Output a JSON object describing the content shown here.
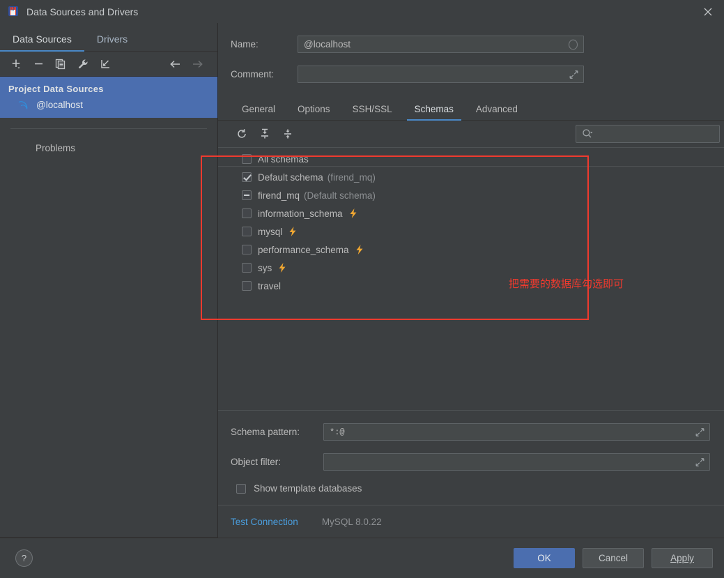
{
  "window": {
    "title": "Data Sources and Drivers",
    "app_icon": "intellij-idea-icon",
    "close_icon": "close-icon"
  },
  "sidebar": {
    "tabs": [
      {
        "label": "Data Sources",
        "selected": true
      },
      {
        "label": "Drivers",
        "selected": false
      }
    ],
    "toolbar": [
      {
        "name": "add-button",
        "icon": "plus-icon"
      },
      {
        "name": "remove-button",
        "icon": "minus-icon"
      },
      {
        "name": "duplicate-button",
        "icon": "copy-icon"
      },
      {
        "name": "properties-button",
        "icon": "wrench-icon"
      },
      {
        "name": "import-button",
        "icon": "import-arrow-icon"
      },
      {
        "name": "back-button",
        "icon": "arrow-left-icon"
      },
      {
        "name": "forward-button",
        "icon": "arrow-right-icon"
      }
    ],
    "group_title": "Project Data Sources",
    "items": [
      {
        "label": "@localhost",
        "icon": "mysql-dolphin-icon",
        "selected": true
      }
    ],
    "problems_label": "Problems"
  },
  "form": {
    "name_label": "Name:",
    "name_value": "@localhost",
    "name_badge_icon": "circle-icon",
    "comment_label": "Comment:",
    "comment_value": "",
    "comment_expand_icon": "expand-diagonal-icon"
  },
  "config_tabs": [
    {
      "label": "General",
      "selected": false
    },
    {
      "label": "Options",
      "selected": false
    },
    {
      "label": "SSH/SSL",
      "selected": false
    },
    {
      "label": "Schemas",
      "selected": true
    },
    {
      "label": "Advanced",
      "selected": false
    }
  ],
  "schema_toolbar": [
    {
      "name": "refresh-button",
      "icon": "refresh-icon"
    },
    {
      "name": "expand-all-button",
      "icon": "expand-all-icon"
    },
    {
      "name": "collapse-all-button",
      "icon": "collapse-all-icon"
    }
  ],
  "search": {
    "placeholder": "",
    "value": "",
    "icon": "search-icon"
  },
  "schema_tree": [
    {
      "label": "All schemas",
      "sub": "",
      "state": "unchecked",
      "bolt": false
    },
    {
      "label": "Default schema",
      "sub": "(firend_mq)",
      "state": "checked",
      "bolt": false
    },
    {
      "label": "firend_mq",
      "sub": "(Default schema)",
      "state": "partial",
      "bolt": false
    },
    {
      "label": "information_schema",
      "sub": "",
      "state": "unchecked",
      "bolt": true
    },
    {
      "label": "mysql",
      "sub": "",
      "state": "unchecked",
      "bolt": true
    },
    {
      "label": "performance_schema",
      "sub": "",
      "state": "unchecked",
      "bolt": true
    },
    {
      "label": "sys",
      "sub": "",
      "state": "unchecked",
      "bolt": true
    },
    {
      "label": "travel",
      "sub": "",
      "state": "unchecked",
      "bolt": false
    }
  ],
  "annotation": {
    "text": "把需要的数据库勾选即可",
    "color": "#f03a2e"
  },
  "bottom": {
    "schema_pattern_label": "Schema pattern:",
    "schema_pattern_value": "*:@",
    "object_filter_label": "Object filter:",
    "object_filter_value": "",
    "show_template_label": "Show template databases",
    "show_template_checked": false,
    "expand_icon": "expand-diagonal-icon"
  },
  "test": {
    "link_label": "Test Connection",
    "driver_version": "MySQL 8.0.22"
  },
  "footer": {
    "help_label": "?",
    "ok_label": "OK",
    "cancel_label": "Cancel",
    "apply_label": "Apply"
  },
  "colors": {
    "accent": "#4a88c7",
    "selection": "#4b6eaf",
    "background": "#3c3f41",
    "bolt": "#f0a732",
    "link": "#4a9ede",
    "annotation": "#f03a2e"
  }
}
